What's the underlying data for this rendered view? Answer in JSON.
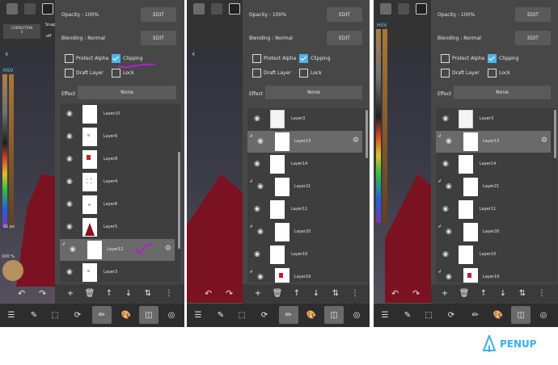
{
  "panels": [
    {
      "opacity_label": "Opacity : 100%",
      "blending_label": "Blending : Normal",
      "edit_label": "EDIT",
      "checkboxes": [
        {
          "label": "Protect Alpha",
          "checked": false
        },
        {
          "label": "Clipping",
          "checked": true
        },
        {
          "label": "Draft Layer",
          "checked": false
        },
        {
          "label": "Lock",
          "checked": false
        }
      ],
      "effect_label": "Effect",
      "effect_value": "None",
      "toolbar_top": {
        "label1": "CORRECTION",
        "label2": "0",
        "label3": "Snap",
        "label4": "off"
      },
      "side_values": {
        "hsv": "HSV",
        "size": "91 px",
        "opacity": "100 %"
      },
      "layers": [
        {
          "name": "Layer10",
          "clip": false,
          "selected": false,
          "thumb": "blank"
        },
        {
          "name": "Layer9",
          "clip": false,
          "selected": false,
          "thumb": "dots"
        },
        {
          "name": "Layer8",
          "clip": false,
          "selected": false,
          "thumb": "red-small"
        },
        {
          "name": "Layer4",
          "clip": false,
          "selected": false,
          "thumb": "red-dots"
        },
        {
          "name": "Layer6",
          "clip": false,
          "selected": false,
          "thumb": "dots"
        },
        {
          "name": "Layer5",
          "clip": false,
          "selected": false,
          "thumb": "figure"
        },
        {
          "name": "Layer12",
          "clip": true,
          "selected": true,
          "thumb": "blank"
        },
        {
          "name": "Layer3",
          "clip": false,
          "selected": false,
          "thumb": "dots"
        }
      ]
    },
    {
      "opacity_label": "Opacity : 100%",
      "blending_label": "Blending : Normal",
      "edit_label": "EDIT",
      "checkboxes": [
        {
          "label": "Protect Alpha",
          "checked": false
        },
        {
          "label": "Clipping",
          "checked": true
        },
        {
          "label": "Draft Layer",
          "checked": false
        },
        {
          "label": "Lock",
          "checked": false
        }
      ],
      "effect_label": "Effect",
      "effect_value": "None",
      "layers": [
        {
          "name": "Layer3",
          "clip": false,
          "selected": false,
          "thumb": "sketch"
        },
        {
          "name": "Layer13",
          "clip": true,
          "selected": true,
          "thumb": "blank"
        },
        {
          "name": "Layer14",
          "clip": false,
          "selected": false,
          "thumb": "blank"
        },
        {
          "name": "Layer21",
          "clip": true,
          "selected": false,
          "thumb": "blank"
        },
        {
          "name": "Layer11",
          "clip": false,
          "selected": false,
          "thumb": "blank"
        },
        {
          "name": "Layer20",
          "clip": true,
          "selected": false,
          "thumb": "blank"
        },
        {
          "name": "Layer10",
          "clip": false,
          "selected": false,
          "thumb": "blank"
        },
        {
          "name": "Layer19",
          "clip": true,
          "selected": false,
          "thumb": "red-small"
        }
      ]
    },
    {
      "opacity_label": "Opacity : 100%",
      "blending_label": "Blending : Normal",
      "edit_label": "EDIT",
      "checkboxes": [
        {
          "label": "Protect Alpha",
          "checked": false
        },
        {
          "label": "Clipping",
          "checked": true
        },
        {
          "label": "Draft Layer",
          "checked": false
        },
        {
          "label": "Lock",
          "checked": false
        }
      ],
      "effect_label": "Effect",
      "effect_value": "None",
      "side_values": {
        "hsv": "HSV"
      },
      "layers": [
        {
          "name": "Layer3",
          "clip": false,
          "selected": false,
          "thumb": "sketch"
        },
        {
          "name": "Layer13",
          "clip": true,
          "selected": true,
          "thumb": "blank"
        },
        {
          "name": "Layer14",
          "clip": false,
          "selected": false,
          "thumb": "blank"
        },
        {
          "name": "Layer21",
          "clip": true,
          "selected": false,
          "thumb": "blank"
        },
        {
          "name": "Layer11",
          "clip": false,
          "selected": false,
          "thumb": "blank"
        },
        {
          "name": "Layer20",
          "clip": true,
          "selected": false,
          "thumb": "blank"
        },
        {
          "name": "Layer10",
          "clip": false,
          "selected": false,
          "thumb": "blank"
        },
        {
          "name": "Layer19",
          "clip": true,
          "selected": false,
          "thumb": "red-small"
        }
      ]
    }
  ],
  "icons": {
    "eye": "eye-icon",
    "gear": "gear-icon",
    "clip": "clip-arrow-icon",
    "add": "add-icon",
    "delete": "trash-icon",
    "up": "arrow-up-icon",
    "down": "arrow-down-icon",
    "merge": "merge-icon",
    "more": "more-vertical-icon",
    "menu": "menu-icon",
    "edit": "edit-icon",
    "select": "selection-icon",
    "rotate": "rotate-icon",
    "brush": "brush-icon",
    "palette": "palette-icon",
    "layers": "layers-icon",
    "settings": "dots-circle-icon"
  },
  "branding": {
    "name": "PENUP",
    "color": "#3ab0e6"
  },
  "accent": "#4fb3e8",
  "annotation_color": "#b21fd0"
}
